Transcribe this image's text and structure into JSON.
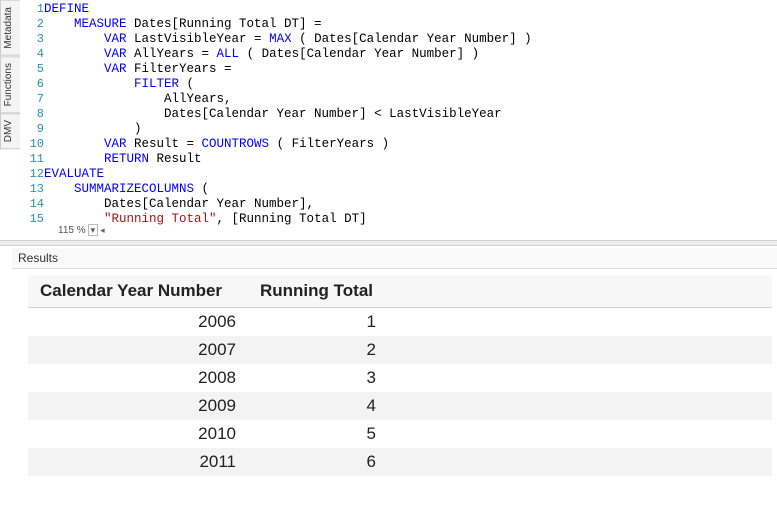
{
  "sidebar_tabs": {
    "metadata": "Metadata",
    "functions": "Functions",
    "dmv": "DMV"
  },
  "code": {
    "lines": [
      "1",
      "2",
      "3",
      "4",
      "5",
      "6",
      "7",
      "8",
      "9",
      "10",
      "11",
      "12",
      "13",
      "14",
      "15"
    ],
    "l1_define": "DEFINE",
    "l2_measure": "MEASURE",
    "l2_expr": " Dates[Running Total DT] =",
    "l3_var": "VAR",
    "l3_name": " LastVisibleYear = ",
    "l3_fn": "MAX",
    "l3_args": " ( Dates[Calendar Year Number] )",
    "l4_var": "VAR",
    "l4_name": " AllYears = ",
    "l4_fn": "ALL",
    "l4_args": " ( Dates[Calendar Year Number] )",
    "l5_var": "VAR",
    "l5_name": " FilterYears =",
    "l6_fn": "FILTER",
    "l6_open": " (",
    "l7": "AllYears,",
    "l8": "Dates[Calendar Year Number] < LastVisibleYear",
    "l9": ")",
    "l10_var": "VAR",
    "l10_name": " Result = ",
    "l10_fn": "COUNTROWS",
    "l10_args": " ( FilterYears )",
    "l11_ret": "RETURN",
    "l11_val": " Result",
    "l12_eval": "EVALUATE",
    "l13_fn": "SUMMARIZECOLUMNS",
    "l13_open": " (",
    "l14": "Dates[Calendar Year Number],",
    "l15_str": "\"Running Total\"",
    "l15_rest": ", [Running Total DT]"
  },
  "zoom": {
    "level": "115 %",
    "dropdown": "▾",
    "nav": "◂"
  },
  "results": {
    "title": "Results",
    "columns": {
      "year": "Calendar Year Number",
      "rt": "Running Total"
    },
    "rows": [
      {
        "year": "2006",
        "rt": "1"
      },
      {
        "year": "2007",
        "rt": "2"
      },
      {
        "year": "2008",
        "rt": "3"
      },
      {
        "year": "2009",
        "rt": "4"
      },
      {
        "year": "2010",
        "rt": "5"
      },
      {
        "year": "2011",
        "rt": "6"
      }
    ]
  },
  "chart_data": {
    "type": "table",
    "columns": [
      "Calendar Year Number",
      "Running Total"
    ],
    "rows": [
      [
        2006,
        1
      ],
      [
        2007,
        2
      ],
      [
        2008,
        3
      ],
      [
        2009,
        4
      ],
      [
        2010,
        5
      ],
      [
        2011,
        6
      ]
    ]
  }
}
